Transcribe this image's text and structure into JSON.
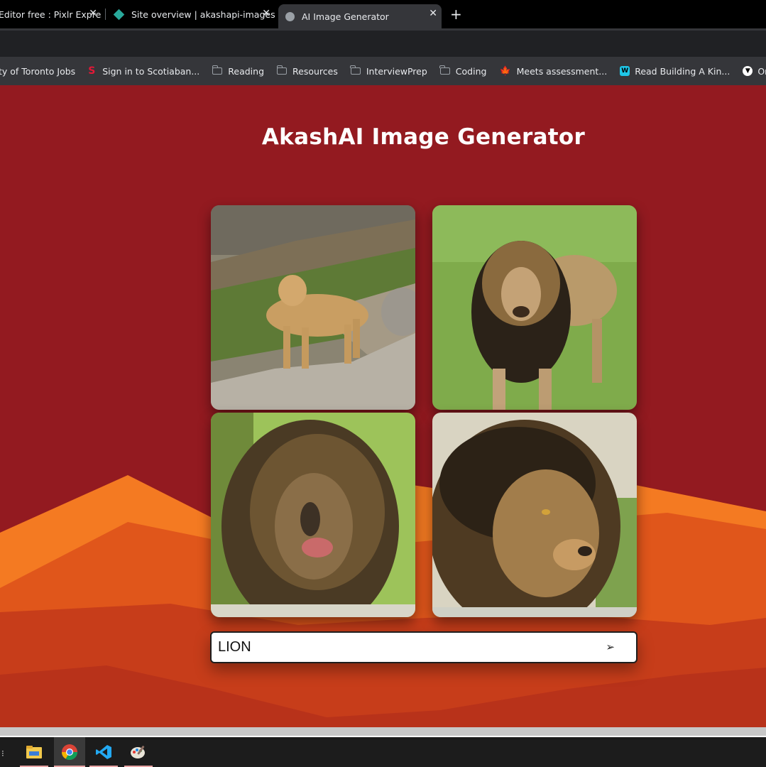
{
  "browser": {
    "tabs": [
      {
        "title": "Editor free : Pixlr Express",
        "active": false
      },
      {
        "title": "Site overview | akashapi-images",
        "active": false
      },
      {
        "title": "AI Image Generator",
        "active": true
      }
    ],
    "new_tab_symbol": "+",
    "close_symbol": "✕",
    "bookmarks": [
      {
        "label": "ty of Toronto Jobs",
        "icon": "none"
      },
      {
        "label": "Sign in to Scotiaban...",
        "icon": "scotiabank-icon"
      },
      {
        "label": "Reading",
        "icon": "folder-icon"
      },
      {
        "label": "Resources",
        "icon": "folder-icon"
      },
      {
        "label": "InterviewPrep",
        "icon": "folder-icon"
      },
      {
        "label": "Coding",
        "icon": "folder-icon"
      },
      {
        "label": "Meets assessment...",
        "icon": "maple-leaf-icon"
      },
      {
        "label": "Read Building A Kin...",
        "icon": "w-icon"
      },
      {
        "label": "Ontario Public Servi...",
        "icon": "ontario-icon"
      }
    ]
  },
  "app": {
    "title": "AkashAI Image Generator",
    "images": [
      {
        "subject": "lioness standing on rocks"
      },
      {
        "subject": "lion standing on grass"
      },
      {
        "subject": "lion face close-up"
      },
      {
        "subject": "lion profile portrait"
      }
    ],
    "prompt_value": "LION",
    "send_symbol": "➢"
  },
  "colors": {
    "background": "#931a20",
    "mountain_light": "#f47a22",
    "mountain_mid": "#e0561b",
    "mountain_dark": "#b8321a"
  },
  "taskbar": {
    "apps": [
      {
        "name": "file-explorer-icon"
      },
      {
        "name": "chrome-icon"
      },
      {
        "name": "vscode-icon"
      },
      {
        "name": "paint-icon"
      }
    ]
  }
}
